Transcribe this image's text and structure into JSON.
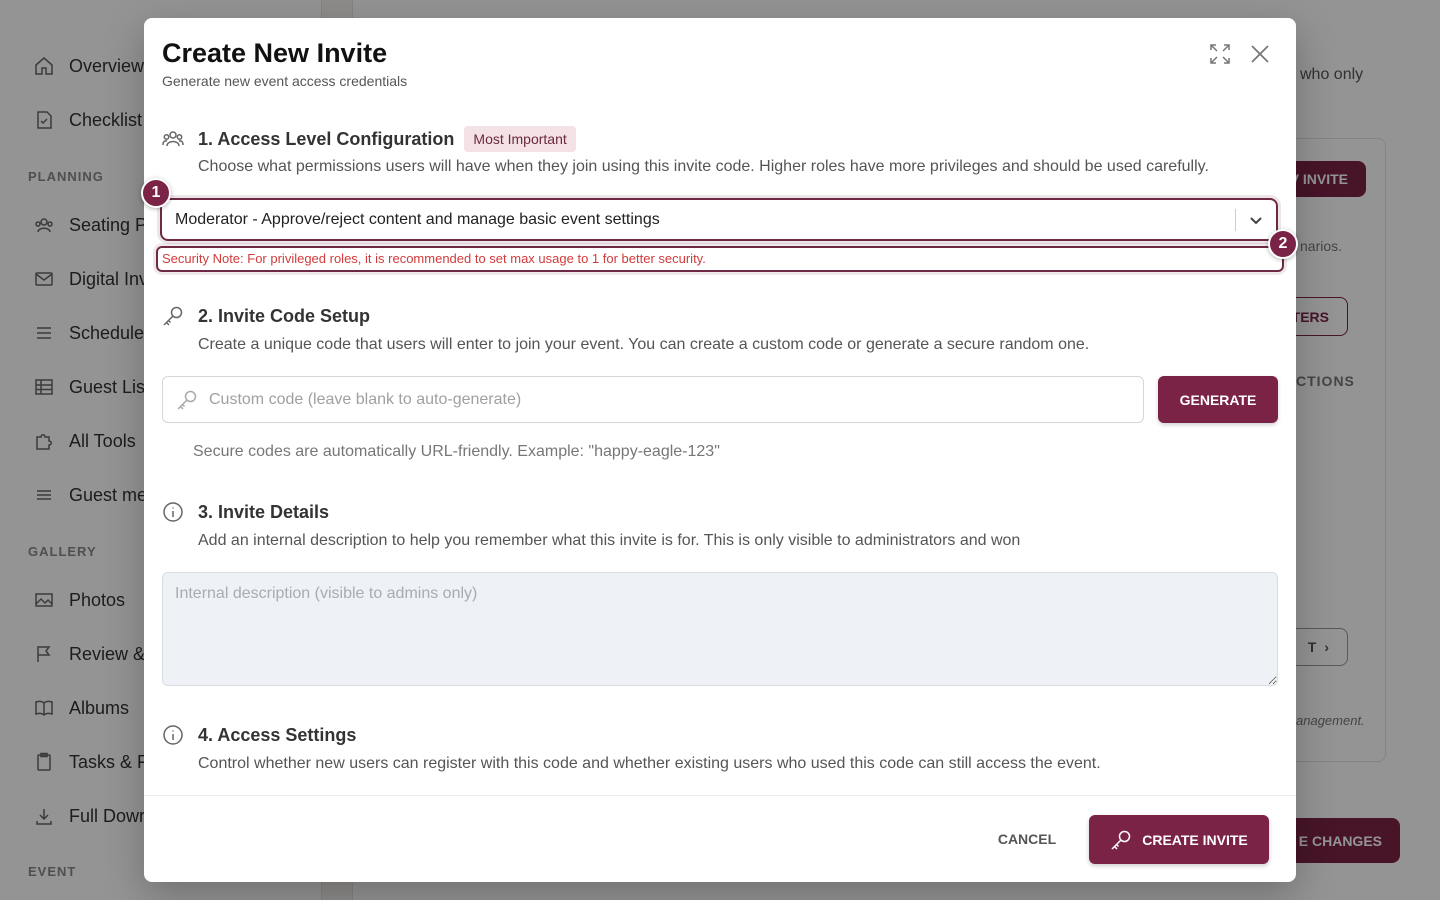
{
  "background": {
    "sidebar": {
      "items": [
        {
          "label": "Overview",
          "icon": "home-icon"
        },
        {
          "label": "Checklist",
          "icon": "checklist-icon"
        },
        {
          "label": "Seating P",
          "icon": "users-icon"
        },
        {
          "label": "Digital Inv",
          "icon": "mail-icon"
        },
        {
          "label": "Schedule",
          "icon": "list-icon"
        },
        {
          "label": "Guest Lis",
          "icon": "table-icon"
        },
        {
          "label": "All Tools",
          "icon": "puzzle-icon"
        },
        {
          "label": "Guest me",
          "icon": "menu-icon"
        },
        {
          "label": "Photos",
          "icon": "photo-icon"
        },
        {
          "label": "Review &",
          "icon": "flag-icon"
        },
        {
          "label": "Albums",
          "icon": "book-icon"
        },
        {
          "label": "Tasks & F",
          "icon": "clipboard-icon"
        },
        {
          "label": "Full Dowr",
          "icon": "download-icon"
        }
      ],
      "sections": [
        "PLANNING",
        "GALLERY",
        "EVENT"
      ]
    },
    "main": {
      "text_who_only": "who only",
      "new_invite_button": "V INVITE",
      "scenarios_text": "narios.",
      "filters_button": "TERS",
      "actions_header": "CTIONS",
      "next_button": "T",
      "management_text": "anagement.",
      "save_changes_button": "E CHANGES"
    }
  },
  "modal": {
    "title": "Create New Invite",
    "subtitle": "Generate new event access credentials",
    "section1": {
      "title": "1. Access Level Configuration",
      "badge": "Most Important",
      "description": "Choose what permissions users will have when they join using this invite code. Higher roles have more privileges and should be used carefully.",
      "selected_role": "Moderator - Approve/reject content and manage basic event settings",
      "security_note": "Security Note: For privileged roles, it is recommended to set max usage to 1 for better security."
    },
    "section2": {
      "title": "2. Invite Code Setup",
      "description": "Create a unique code that users will enter to join your event. You can create a custom code or generate a secure random one.",
      "placeholder": "Custom code (leave blank to auto-generate)",
      "generate_label": "GENERATE",
      "hint": "Secure codes are automatically URL-friendly. Example: \"happy-eagle-123\""
    },
    "section3": {
      "title": "3. Invite Details",
      "description": "Add an internal description to help you remember what this invite is for. This is only visible to administrators and won",
      "placeholder": "Internal description (visible to admins only)"
    },
    "section4": {
      "title": "4. Access Settings",
      "description": "Control whether new users can register with this code and whether existing users who used this code can still access the event."
    },
    "footer": {
      "cancel_label": "CANCEL",
      "create_label": "CREATE INVITE"
    }
  },
  "markers": [
    "1",
    "2"
  ],
  "colors": {
    "brand": "#7b2346",
    "error": "#d23b3b",
    "badge_bg": "#f3e1e6"
  }
}
